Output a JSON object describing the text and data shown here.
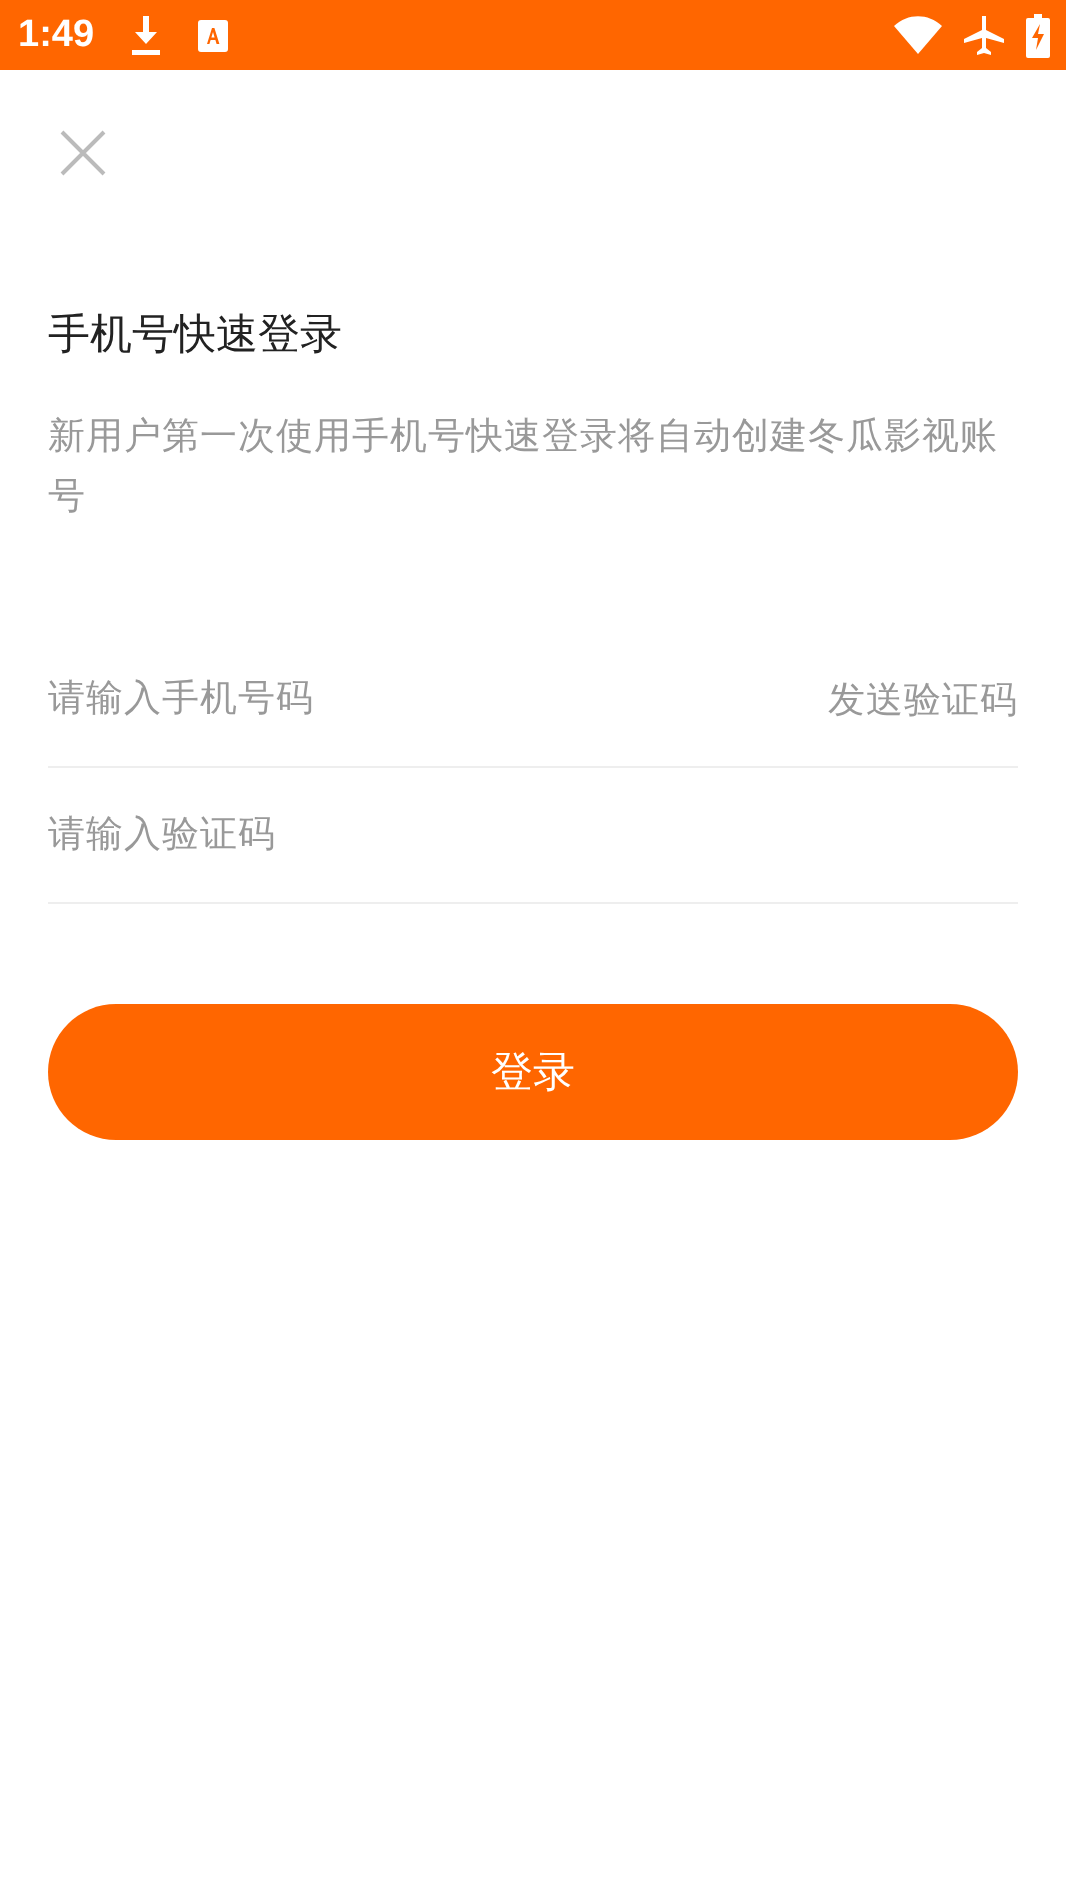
{
  "status_bar": {
    "time": "1:49"
  },
  "title": "手机号快速登录",
  "description": "新用户第一次使用手机号快速登录将自动创建冬瓜影视账号",
  "phone_field": {
    "placeholder": "请输入手机号码"
  },
  "send_code_link": "发送验证码",
  "code_field": {
    "placeholder": "请输入验证码"
  },
  "login_button": "登录"
}
